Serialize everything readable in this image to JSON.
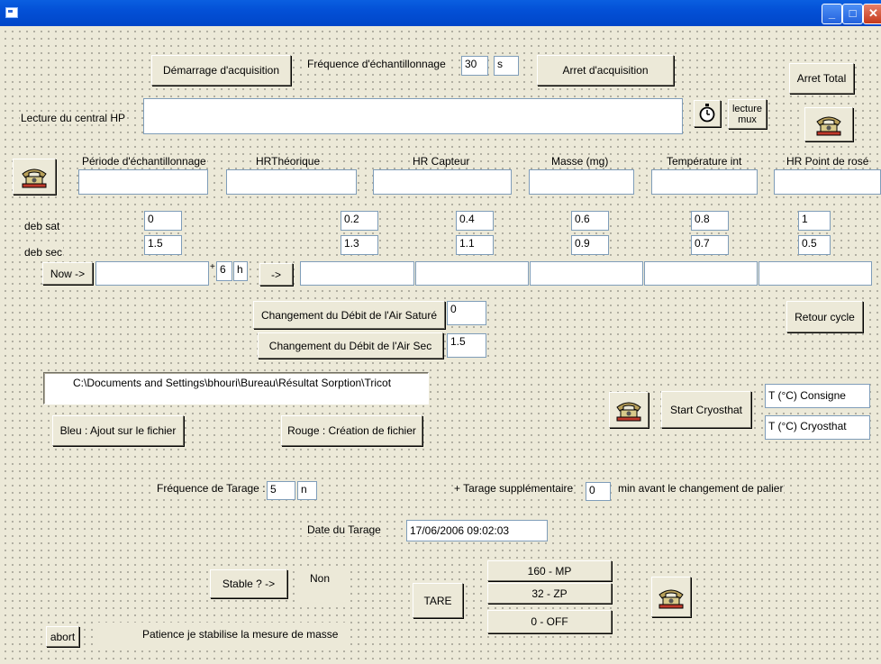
{
  "window": {
    "title": ""
  },
  "acquisition": {
    "start_label": "Démarrage d'acquisition",
    "freq_label": "Fréquence d'échantillonnage",
    "freq_value": "30",
    "freq_unit": "s",
    "stop_label": "Arret d'acquisition",
    "stop_total_label": "Arret Total"
  },
  "hp": {
    "label": "Lecture du central HP",
    "value": "",
    "lecture_mux_label": "lecture\nmux"
  },
  "columns": {
    "periode": "Période d'échantillonnage",
    "hr_theo": "HRThéorique",
    "hr_capteur": "HR Capteur",
    "masse": "Masse (mg)",
    "temp_int": "Température int",
    "hr_rose": "HR Point de rosé"
  },
  "deb_sat": {
    "label": "deb sat",
    "values": [
      "0",
      "0.2",
      "0.4",
      "0.6",
      "0.8",
      "1"
    ]
  },
  "deb_sec": {
    "label": "deb sec",
    "values": [
      "1.5",
      "1.3",
      "1.1",
      "0.9",
      "0.7",
      "0.5"
    ]
  },
  "now": {
    "button_label": "Now ->",
    "plus": "+",
    "hours_value": "6",
    "hours_unit": "h",
    "arrow_label": "->"
  },
  "debit": {
    "sat_label": "Changement du Débit de l'Air Saturé",
    "sat_value": "0",
    "sec_label": "Changement du Débit de l'Air Sec",
    "sec_value": "1.5",
    "retour_label": "Retour cycle"
  },
  "file": {
    "path": "C:\\Documents and Settings\\bhouri\\Bureau\\Résultat Sorption\\Tricot",
    "bleu_label": "Bleu : Ajout sur le fichier",
    "rouge_label": "Rouge : Création de fichier"
  },
  "cryostat": {
    "start_label": "Start Cryosthat",
    "consigne_value": "T (°C) Consigne",
    "cryostat_value": "T (°C) Cryosthat"
  },
  "tarage": {
    "freq_label": "Fréquence de Tarage :",
    "freq_value": "5",
    "freq_unit": "n",
    "supp_label": "+ Tarage supplémentaire",
    "supp_value": "0",
    "supp_suffix": "min  avant  le changement de palier",
    "date_label": "Date du Tarage",
    "date_value": "17/06/2006 09:02:03"
  },
  "stable": {
    "button_label": "Stable ? ->",
    "status": "Non",
    "tare_label": "TARE",
    "mp_label": "160 - MP",
    "zp_label": "32 - ZP",
    "off_label": "0 - OFF"
  },
  "footer": {
    "abort_label": "abort",
    "message": "Patience je stabilise la mesure de masse"
  },
  "icons": {
    "phone": "phone-icon",
    "stopwatch": "stopwatch-icon"
  }
}
